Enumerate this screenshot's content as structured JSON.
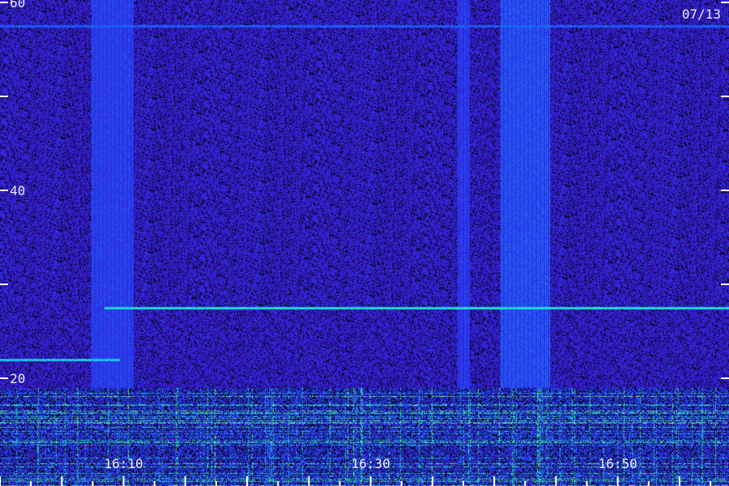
{
  "chart_data": {
    "type": "heatmap",
    "title": "",
    "date_label": "07/13",
    "xlabel": "",
    "ylabel": "",
    "y_axis": {
      "ylim": [
        10,
        60
      ],
      "tick_labels": [
        "60",
        "40",
        "20"
      ],
      "tick_values": [
        60,
        50,
        40,
        30,
        20
      ],
      "ticks_both_sides": true
    },
    "x_axis": {
      "tick_labels": [
        "16:10",
        "16:30",
        "16:50"
      ],
      "labeled_tick_values": [
        "16:10",
        "16:30",
        "16:50"
      ],
      "major_tick_times": [
        "16:05",
        "16:10",
        "16:15",
        "16:20",
        "16:25",
        "16:30",
        "16:35",
        "16:40",
        "16:45",
        "16:50",
        "16:55"
      ],
      "minor_tick_interval_min": 2.5
    },
    "colormap": [
      "#2a0a7a",
      "#3a1ad8",
      "#1560ff",
      "#1ad6e6",
      "#3cff70",
      "#f0ff30"
    ],
    "background_level": 0.2,
    "features": {
      "horizontal_lines": [
        {
          "y": 27.5,
          "from": "16:08.4",
          "to": "16:59",
          "level": 0.55
        },
        {
          "y": 22.0,
          "from": "16:00",
          "to": "16:09.7",
          "level": 0.5
        },
        {
          "y": 17.3,
          "from": "16:00",
          "to": "16:59",
          "level": 0.55
        },
        {
          "y": 16.3,
          "from": "16:00",
          "to": "16:14.5",
          "level": 0.65
        },
        {
          "y": 57.5,
          "from": "16:00",
          "to": "16:59",
          "level": 0.3
        }
      ],
      "vertical_bands": [
        {
          "from": "16:07.4",
          "to": "16:10.8",
          "level": 0.4
        },
        {
          "from": "16:37.0",
          "to": "16:38.0",
          "level": 0.38
        },
        {
          "from": "16:40.5",
          "to": "16:44.5",
          "level": 0.45
        }
      ],
      "low_band_interference": {
        "y_from": 10,
        "y_to": 19,
        "level": 0.5
      }
    }
  }
}
